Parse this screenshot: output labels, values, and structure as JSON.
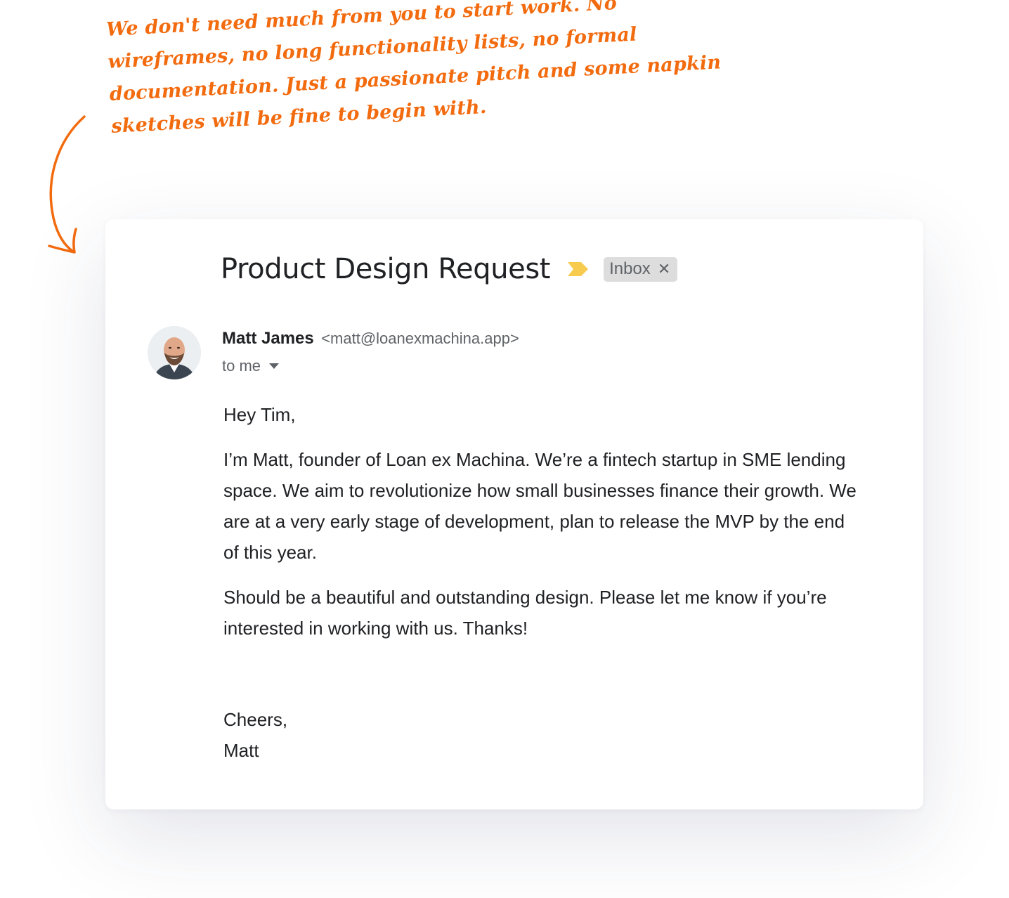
{
  "annotation": {
    "lines": [
      "We don't need much from you to start work. No",
      "wireframes, no long functionality lists, no formal",
      "documentation. Just a passionate pitch and some napkin",
      "sketches will be fine to begin with."
    ]
  },
  "email": {
    "subject": "Product Design Request",
    "label": "Inbox",
    "label_remove": "✕",
    "sender": {
      "name": "Matt James",
      "email": "<matt@loanexmachina.app>"
    },
    "recipient": "to me",
    "body": {
      "greeting": "Hey Tim,",
      "paragraphs": [
        "I’m Matt, founder of Loan ex Machina. We’re a fintech startup in SME lending space. We aim to revolutionize how small businesses finance their growth. We are at a very early stage of development, plan to release the MVP by the end of this year.",
        "Should be a beautiful and outstanding design. Please let me know if you’re interested in working with us. Thanks!"
      ],
      "closing": "Cheers,",
      "signature": "Matt"
    }
  },
  "colors": {
    "annotation": "#f26b0f",
    "importance_marker": "#f7cb4d",
    "label_chip": "#dddddd",
    "text_primary": "#202124",
    "text_secondary": "#5f6368"
  },
  "icons": {
    "importance": "importance-marker-icon",
    "dropdown": "chevron-down-icon",
    "remove_label": "close-icon",
    "arrow": "curved-arrow-icon"
  }
}
